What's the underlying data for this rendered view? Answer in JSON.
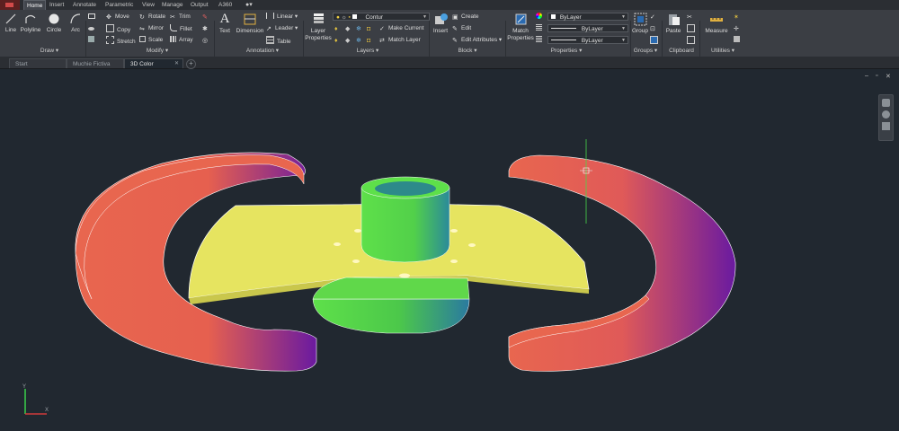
{
  "menu": {
    "tabs": [
      "Home",
      "Insert",
      "Annotate",
      "Parametric",
      "View",
      "Manage",
      "Output",
      "A360"
    ],
    "active": "Home"
  },
  "ribbon": {
    "draw": {
      "title": "Draw",
      "line": "Line",
      "polyline": "Polyline",
      "circle": "Circle",
      "arc": "Arc"
    },
    "modify": {
      "title": "Modify",
      "move": "Move",
      "rotate": "Rotate",
      "trim": "Trim",
      "copy": "Copy",
      "mirror": "Mirror",
      "fillet": "Fillet",
      "stretch": "Stretch",
      "scale": "Scale",
      "array": "Array"
    },
    "annotation": {
      "title": "Annotation",
      "text": "Text",
      "dimension": "Dimension",
      "linear": "Linear",
      "leader": "Leader",
      "table": "Table"
    },
    "layers": {
      "title": "Layers",
      "layer_properties": "Layer Properties",
      "layer_name": "Contur",
      "make_current": "Make Current",
      "match_layer": "Match Layer"
    },
    "block": {
      "title": "Block",
      "insert": "Insert",
      "create": "Create",
      "edit": "Edit",
      "edit_attributes": "Edit Attributes"
    },
    "properties": {
      "title": "Properties",
      "match_properties": "Match Properties",
      "color": "ByLayer",
      "linetype": "ByLayer",
      "lineweight": "ByLayer"
    },
    "groups": {
      "title": "Groups",
      "group": "Group"
    },
    "clipboard": {
      "title": "Clipboard",
      "paste": "Paste"
    },
    "utilities": {
      "title": "Utilities",
      "measure": "Measure"
    }
  },
  "doc_tabs": {
    "start": "Start",
    "file1": "Muchie Fictiva",
    "file2": "3D Color",
    "active": "3D Color"
  },
  "viewport": {
    "ucs_y": "Y",
    "ucs_x": "X"
  },
  "colors": {
    "background": "#212830",
    "ribbon": "#3b3e44",
    "arc_red": "#e8664f",
    "arc_purple": "#6a1aa0",
    "plate_yellow": "#e6e460",
    "hub_green": "#5ee04a",
    "hub_teal": "#2a8a9a"
  }
}
